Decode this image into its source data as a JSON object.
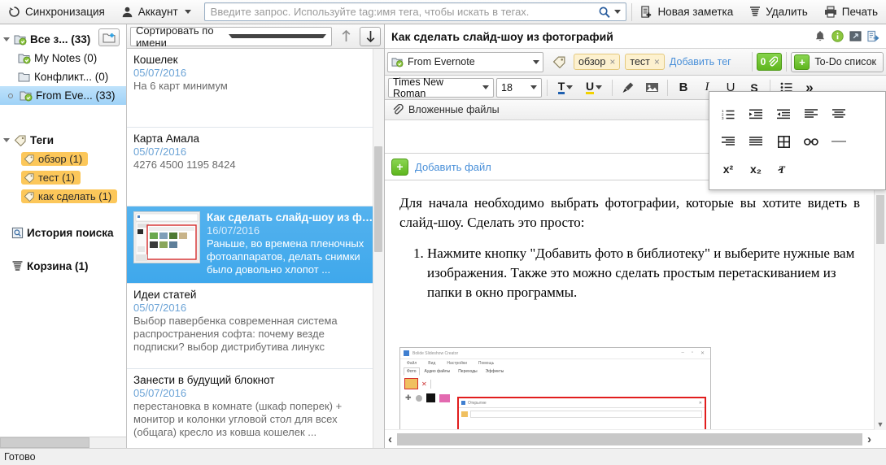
{
  "toolbar": {
    "sync_label": "Синхронизация",
    "account_label": "Аккаунт",
    "new_note_label": "Новая заметка",
    "delete_label": "Удалить",
    "print_label": "Печать",
    "search_placeholder": "Введите запрос. Используйте tag:имя тега, чтобы искать в тегах.",
    "search_value": ""
  },
  "sidebar": {
    "notebooks": [
      {
        "label": "Все з... (33)",
        "selected": false,
        "level": 0
      },
      {
        "label": "My Notes (0)",
        "selected": false,
        "level": 1
      },
      {
        "label": "Конфликт... (0)",
        "selected": false,
        "level": 1
      },
      {
        "label": "From Eve... (33)",
        "selected": true,
        "level": 1
      }
    ],
    "tags_header": "Теги",
    "tags": [
      {
        "label": "обзор (1)"
      },
      {
        "label": "тест (1)"
      },
      {
        "label": "как сделать (1)"
      }
    ],
    "search_history": "История поиска",
    "trash": "Корзина (1)",
    "new_notebook_icon": "new-notebook-icon",
    "tag_icon": "tag-icon",
    "history_icon": "history-icon",
    "trash_icon": "trash-icon"
  },
  "notelist": {
    "sort_label": "Сортировать по имени",
    "sort_asc_icon": "arrow-up-icon",
    "sort_desc_icon": "arrow-down-icon",
    "items": [
      {
        "title": "Кошелек",
        "date": "05/07/2016",
        "snippet": "На 6 карт минимум",
        "selected": false,
        "thumb": false
      },
      {
        "title": "Карта Амала",
        "date": "05/07/2016",
        "snippet": "4276 4500 1195 8424",
        "selected": false,
        "thumb": false
      },
      {
        "title": "Как сделать слайд-шоу из фо...",
        "date": "16/07/2016",
        "snippet": "Раньше, во времена пленочных фотоаппаратов, делать снимки было довольно хлопот ...",
        "selected": true,
        "thumb": true
      },
      {
        "title": "Идеи статей",
        "date": "05/07/2016",
        "snippet": "Выбор павербенка современная система распространения софта: почему везде подписки? выбор дистрибутива линукс",
        "selected": false,
        "thumb": false
      },
      {
        "title": "Занести в будущий блокнот",
        "date": "05/07/2016",
        "snippet": "перестановка в комнате (шкаф поперек) + монитор и колонки угловой стол для всех (общага) кресло из ковша кошелек  ...",
        "selected": false,
        "thumb": false
      }
    ]
  },
  "editor": {
    "note_title": "Как сделать слайд-шоу из фотографий",
    "header_icons": [
      "reminder-bell-icon",
      "info-icon",
      "presentation-icon",
      "share-icon"
    ],
    "notebook": "From Evernote",
    "tags": [
      {
        "label": "обзор",
        "remove": "×"
      },
      {
        "label": "тест",
        "remove": "×"
      }
    ],
    "add_tag_label": "Добавить тег",
    "attachment_count": "0",
    "todo_label": "To-Do список",
    "todo_plus": "+",
    "font_family": "Times New Roman",
    "font_size": "18",
    "format_buttons": [
      {
        "name": "text-color-icon",
        "glyph": "T"
      },
      {
        "name": "highlight-color-icon",
        "glyph": "U"
      },
      {
        "name": "clear-formatting-icon",
        "glyph": "✐"
      },
      {
        "name": "insert-image-icon",
        "glyph": "▣"
      },
      {
        "name": "bold-icon",
        "glyph": "B"
      },
      {
        "name": "italic-icon",
        "glyph": "I"
      },
      {
        "name": "underline-icon",
        "glyph": "U"
      },
      {
        "name": "strikethrough-icon",
        "glyph": "S"
      },
      {
        "name": "bullet-list-icon",
        "glyph": "☰"
      },
      {
        "name": "more-formatting-icon",
        "glyph": "»"
      }
    ],
    "attachments_label": "Вложенные файлы",
    "attachments_collapse_icon": "chevron-up-icon",
    "add_file_label": "Добавить файл",
    "content": {
      "paragraph": "Для начала необходимо выбрать фотографии, которые вы хотите видеть в слайд-шоу. Сделать это просто:",
      "list_items": [
        "Нажмите кнопку \"Добавить фото в библиотеку\" и выберите нужные вам изображения. Также это можно сделать простым перетаскиванием из папки в окно программы."
      ]
    },
    "embedded_screenshot": {
      "window_title": "Bolide Slideshow Creator",
      "menu": [
        "Файл",
        "Вид",
        "Настройки",
        "Помощь"
      ],
      "tabs": [
        "Фото",
        "Аудио файлы",
        "Переходы",
        "Эффекты"
      ],
      "dialog_title": "Открытие"
    }
  },
  "overflow_menu": {
    "rows": [
      [
        {
          "name": "numbered-list-icon",
          "glyph": "⒈"
        },
        {
          "name": "increase-indent-icon",
          "glyph": "⇥"
        },
        {
          "name": "decrease-indent-icon",
          "glyph": "⇤"
        },
        {
          "name": "align-left-icon",
          "glyph": "☰"
        },
        {
          "name": "align-center-icon",
          "glyph": "☰"
        }
      ],
      [
        {
          "name": "align-right-icon",
          "glyph": "☰"
        },
        {
          "name": "align-justify-icon",
          "glyph": "☰"
        },
        {
          "name": "insert-table-icon",
          "glyph": "▦"
        },
        {
          "name": "insert-link-icon",
          "glyph": "⛓"
        },
        {
          "name": "horizontal-rule-icon",
          "glyph": "—"
        }
      ],
      [
        {
          "name": "superscript-icon",
          "glyph": "x²"
        },
        {
          "name": "subscript-icon",
          "glyph": "x₂"
        },
        {
          "name": "format-painter-icon",
          "glyph": "𝙏"
        }
      ]
    ]
  },
  "statusbar": {
    "text": "Готово"
  },
  "colors": {
    "accent_blue": "#3fa8ec",
    "link_blue": "#4a90d9",
    "tag_orange": "#fcc75a",
    "green": "#5fb61e"
  }
}
